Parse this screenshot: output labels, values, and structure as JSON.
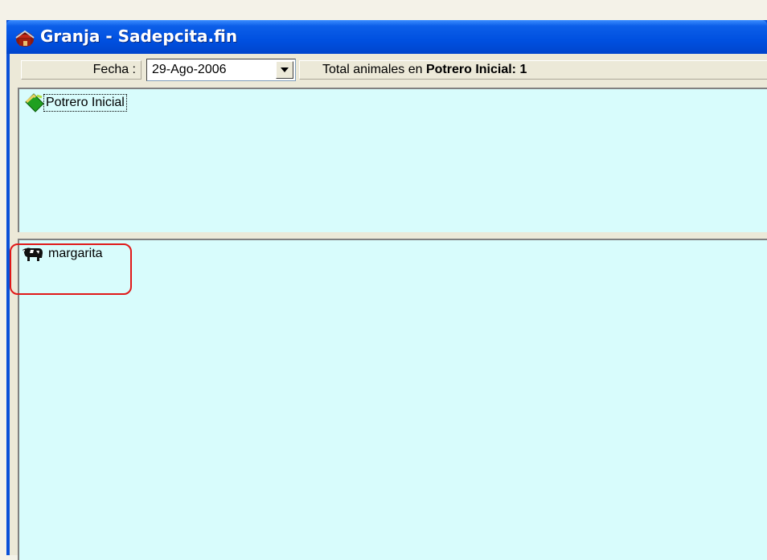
{
  "window": {
    "title": "Granja - Sadepcita.fin",
    "app_icon": "barn-icon"
  },
  "toolbar": {
    "fecha_label": "Fecha :",
    "fecha_value": "29-Ago-2006",
    "total_prefix": "Total animales en",
    "total_bold": "Potrero Inicial: 1"
  },
  "paddocks": {
    "items": [
      {
        "label": "Potrero Inicial",
        "icon": "paddock-icon",
        "focused": true
      }
    ]
  },
  "animals": {
    "items": [
      {
        "label": "margarita",
        "icon": "cow-icon",
        "highlighted": true
      }
    ]
  },
  "colors": {
    "titlebar": "#0050e0",
    "pane_background": "#d8fcfc",
    "highlight": "#e01818"
  }
}
